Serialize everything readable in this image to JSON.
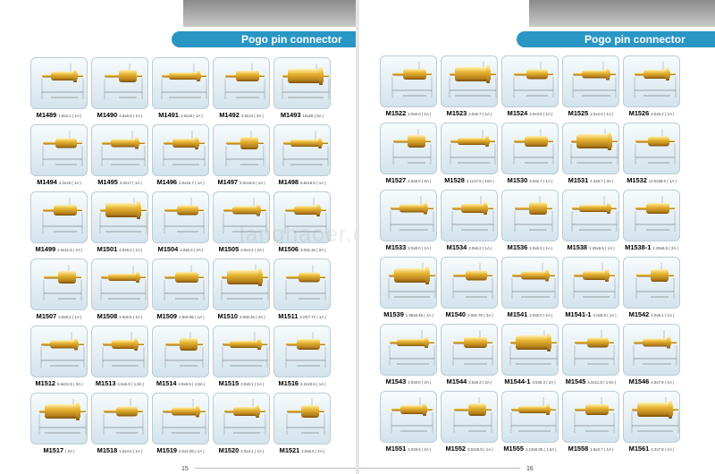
{
  "title": "Pogo pin connector",
  "watermark": "langhaoer.en.alibaba.com",
  "pages": [
    {
      "page_number": "15",
      "items": [
        {
          "code": "M1489",
          "spec": "1.8x2.1 ( 1A )"
        },
        {
          "code": "M1490",
          "spec": "4.5x6.5 ( 1A )"
        },
        {
          "code": "M1491",
          "spec": "1.5x18 ( 1A )"
        },
        {
          "code": "M1492",
          "spec": "2.5x13 ( 3A )"
        },
        {
          "code": "M1493",
          "spec": "10x26 ( 5A )"
        },
        {
          "code": "M1494",
          "spec": "2.2x16 ( 1A )"
        },
        {
          "code": "M1495",
          "spec": "2.2x17 ( 1A )"
        },
        {
          "code": "M1496",
          "spec": "2.0x15.7 ( 1A )"
        },
        {
          "code": "M1497",
          "spec": "3.0x16.6 ( 1A )"
        },
        {
          "code": "M1498",
          "spec": "5.8x16.5 ( 1A )"
        },
        {
          "code": "M1499",
          "spec": "2.0x11.5 ( 1A )"
        },
        {
          "code": "M1501",
          "spec": "2.0x9.2 ( 1A )"
        },
        {
          "code": "M1504",
          "spec": "2.0x6.3 ( 2A )"
        },
        {
          "code": "M1505",
          "spec": "2.0x4.4 ( 2A )"
        },
        {
          "code": "M1506",
          "spec": "3.0x5.15 ( 2A )"
        },
        {
          "code": "M1507",
          "spec": "2.0x8.2 ( 1A )"
        },
        {
          "code": "M1508",
          "spec": "2.5x6.5 ( 1A )"
        },
        {
          "code": "M1509",
          "spec": "1.8x6.95 ( 1A )"
        },
        {
          "code": "M1510",
          "spec": "2.0x8.25 ( 2A )"
        },
        {
          "code": "M1511",
          "spec": "2.0X7.71 ( 1A )"
        },
        {
          "code": "M1512",
          "spec": "8.5x31.5 ( 3A )"
        },
        {
          "code": "M1513",
          "spec": "4.5x6.5 ( 1.5A )"
        },
        {
          "code": "M1514",
          "spec": "4.5x6.5 ( 1.5A )"
        },
        {
          "code": "M1515",
          "spec": "2.0x9.1 ( 1A )"
        },
        {
          "code": "M1516",
          "spec": "2.2x10.5 ( 1A )"
        },
        {
          "code": "M1517",
          "spec": "( 2A )"
        },
        {
          "code": "M1518",
          "spec": "1.5x4.0 ( 1A )"
        },
        {
          "code": "M1519",
          "spec": "2.0x2.55 ( 1A )"
        },
        {
          "code": "M1520",
          "spec": "2.0x4.1 ( 1A )"
        },
        {
          "code": "M1521",
          "spec": "2.0x6.5 ( 1A )"
        }
      ]
    },
    {
      "page_number": "16",
      "items": [
        {
          "code": "M1522",
          "spec": "2.0x6.0 ( 1A )"
        },
        {
          "code": "M1523",
          "spec": "2.0x5.7 ( 1A )"
        },
        {
          "code": "M1524",
          "spec": "2.0x3.5 ( 1A )"
        },
        {
          "code": "M1525",
          "spec": "2.0x4.0 ( 1A )"
        },
        {
          "code": "M1526",
          "spec": "2.0x5.2 ( 1A )"
        },
        {
          "code": "M1527",
          "spec": "4.5x8.0 ( 5A )"
        },
        {
          "code": "M1528",
          "spec": "3.1x17.5 ( 10A )"
        },
        {
          "code": "M1530",
          "spec": "2.0x6.7 ( 1A )"
        },
        {
          "code": "M1531",
          "spec": "4.4x8.7 ( 3A )"
        },
        {
          "code": "M1532",
          "spec": "12.0x38.0 ( 1A )"
        },
        {
          "code": "M1533",
          "spec": "2.0x8.0 ( 1A )"
        },
        {
          "code": "M1534",
          "spec": "2.0x6.2 ( 1A )"
        },
        {
          "code": "M1536",
          "spec": "2.0x6.3 ( 1A )"
        },
        {
          "code": "M1538",
          "spec": "1.25x6.5 ( 1A )"
        },
        {
          "code": "M1538-1",
          "spec": "1.25x6.5 ( 2A )"
        },
        {
          "code": "M1539",
          "spec": "1.58x8.45 ( 1A )"
        },
        {
          "code": "M1540",
          "spec": "2.0x6.75 ( 3A )"
        },
        {
          "code": "M1541",
          "spec": "2.0x8.0 ( 1A )"
        },
        {
          "code": "M1541-1",
          "spec": "2.0x8.8 ( 1A )"
        },
        {
          "code": "M1542",
          "spec": "2.0x8.1 ( 1A )"
        },
        {
          "code": "M1543",
          "spec": "2.0x8.0 ( 2A )"
        },
        {
          "code": "M1544",
          "spec": "2.5x8.3 ( 2A )"
        },
        {
          "code": "M1544-1",
          "spec": "2.5x8.3 ( 2A )"
        },
        {
          "code": "M1545",
          "spec": "5.2x11.5 ( 1.5A )"
        },
        {
          "code": "M1546",
          "spec": "4.5x7.8 ( 1A )"
        },
        {
          "code": "M1551",
          "spec": "4.0x9.5 ( 2A )"
        },
        {
          "code": "M1552",
          "spec": "3.52x9.8 ( 1A )"
        },
        {
          "code": "M1555",
          "spec": "1.13x8.05 ( 1.5A )"
        },
        {
          "code": "M1558",
          "spec": "1.8x3.7 ( 1A )"
        },
        {
          "code": "M1561",
          "spec": "4.2x7.8 ( 1A )"
        }
      ]
    }
  ],
  "colors": {
    "banner": "#2a96c4",
    "brass_light": "#f5d46a",
    "brass_mid": "#d9a520",
    "brass_dark": "#8a5a0e",
    "card_top": "#f7fbfd",
    "card_bottom": "#d3e3ec"
  }
}
